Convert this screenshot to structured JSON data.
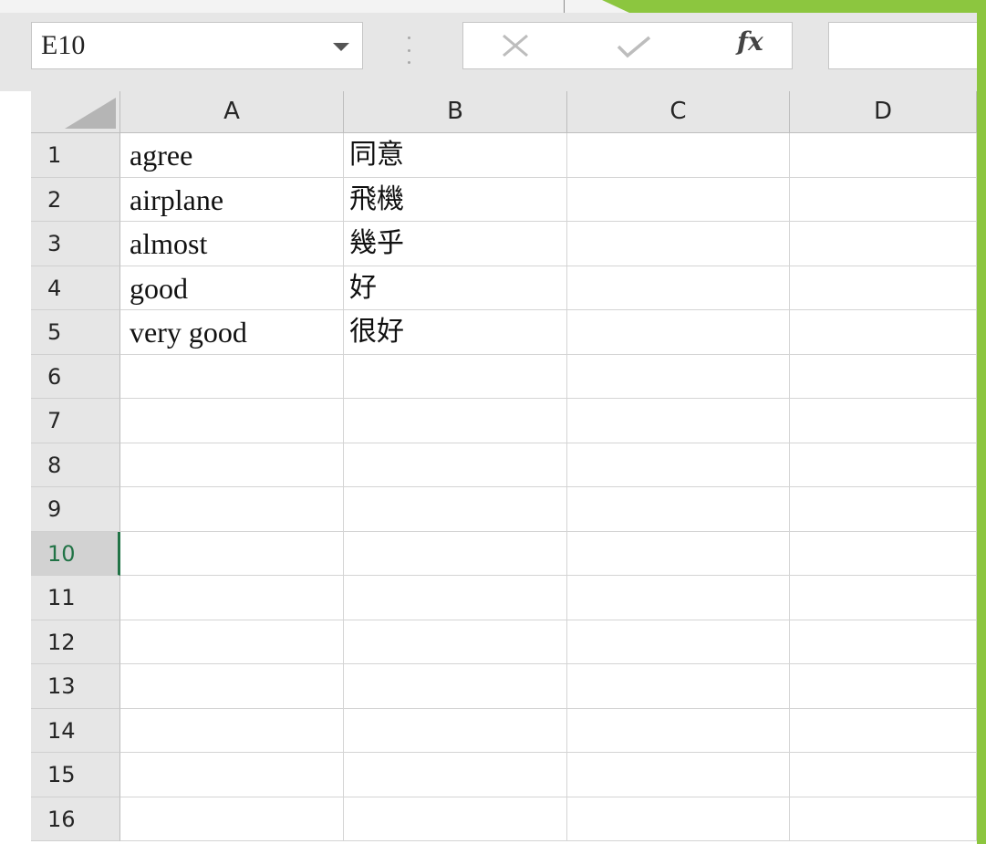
{
  "formula_bar": {
    "name_box": "E10",
    "formula_value": "",
    "icons": {
      "dropdown": "chevron-down-icon",
      "more": "vertical-dots-icon",
      "cancel": "cancel-x-icon",
      "enter": "checkmark-icon",
      "function": "fx-icon"
    },
    "fx_label": "fx"
  },
  "columns": [
    "A",
    "B",
    "C",
    "D"
  ],
  "rows": [
    {
      "num": "1",
      "cells": [
        "agree",
        "同意",
        "",
        ""
      ]
    },
    {
      "num": "2",
      "cells": [
        "airplane",
        "飛機",
        "",
        ""
      ]
    },
    {
      "num": "3",
      "cells": [
        "almost",
        "幾乎",
        "",
        ""
      ]
    },
    {
      "num": "4",
      "cells": [
        "good",
        "好",
        "",
        ""
      ]
    },
    {
      "num": "5",
      "cells": [
        "very good",
        "很好",
        "",
        ""
      ]
    },
    {
      "num": "6",
      "cells": [
        "",
        "",
        "",
        ""
      ]
    },
    {
      "num": "7",
      "cells": [
        "",
        "",
        "",
        ""
      ]
    },
    {
      "num": "8",
      "cells": [
        "",
        "",
        "",
        ""
      ]
    },
    {
      "num": "9",
      "cells": [
        "",
        "",
        "",
        ""
      ]
    },
    {
      "num": "10",
      "cells": [
        "",
        "",
        "",
        ""
      ]
    },
    {
      "num": "11",
      "cells": [
        "",
        "",
        "",
        ""
      ]
    },
    {
      "num": "12",
      "cells": [
        "",
        "",
        "",
        ""
      ]
    },
    {
      "num": "13",
      "cells": [
        "",
        "",
        "",
        ""
      ]
    },
    {
      "num": "14",
      "cells": [
        "",
        "",
        "",
        ""
      ]
    },
    {
      "num": "15",
      "cells": [
        "",
        "",
        "",
        ""
      ]
    },
    {
      "num": "16",
      "cells": [
        "",
        "",
        "",
        ""
      ]
    }
  ],
  "active_cell": "E10",
  "active_row": "10",
  "colors": {
    "accent_green": "#217346",
    "slide_green": "#8cc63f",
    "header_gray": "#e6e6e6"
  }
}
